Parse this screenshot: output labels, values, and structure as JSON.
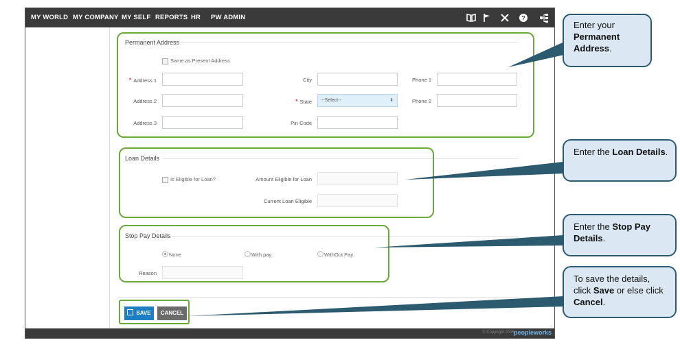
{
  "nav": {
    "items": [
      "MY WORLD",
      "MY COMPANY",
      "MY SELF",
      "REPORTS",
      "HR",
      "PW ADMIN"
    ],
    "icons": [
      "book-icon",
      "flag-icon",
      "tools-icon",
      "help-icon",
      "sitemap-icon"
    ]
  },
  "permanent_address": {
    "title": "Permanent Address",
    "same_as_present": "Same as Present Address",
    "address1_label": "Address 1",
    "address2_label": "Address 2",
    "address3_label": "Address 3",
    "city_label": "City",
    "state_label": "State",
    "state_value": "--Select--",
    "pin_label": "Pin Code",
    "phone1_label": "Phone 1",
    "phone2_label": "Phone 2",
    "required_mark": "*"
  },
  "loan": {
    "title": "Loan Details",
    "eligible_label": "Is Eligible for Loan?",
    "amount_label": "Amount Eligible for Loan",
    "current_label": "Current Loan Eligible"
  },
  "stop_pay": {
    "title": "Stop Pay Details",
    "options": [
      "None",
      "With pay",
      "WithOut Pay"
    ],
    "selected": "None",
    "reason_label": "Reason"
  },
  "buttons": {
    "save": "SAVE",
    "cancel": "CANCEL"
  },
  "footer": {
    "copyright": "© Copyright 2015",
    "brand": "peopleworks"
  },
  "callouts": {
    "address": {
      "pre": "Enter your ",
      "bold": "Permanent Address",
      "post": "."
    },
    "loan": {
      "pre": "Enter the ",
      "bold": "Loan Details",
      "post": "."
    },
    "stoppay": {
      "pre": "Enter the  ",
      "bold": "Stop Pay Details",
      "post": "."
    },
    "save": {
      "pre": "To save the details, click ",
      "bold1": "Save",
      "mid": " or else click ",
      "bold2": "Cancel",
      "post": "."
    }
  },
  "colors": {
    "nav_bg": "#3a3a3a",
    "highlight": "#6aa83a",
    "callout_bg": "#dbe8f3",
    "callout_border": "#2c5a6e",
    "save_btn": "#1f7fc4",
    "cancel_btn": "#6b6b6b"
  }
}
